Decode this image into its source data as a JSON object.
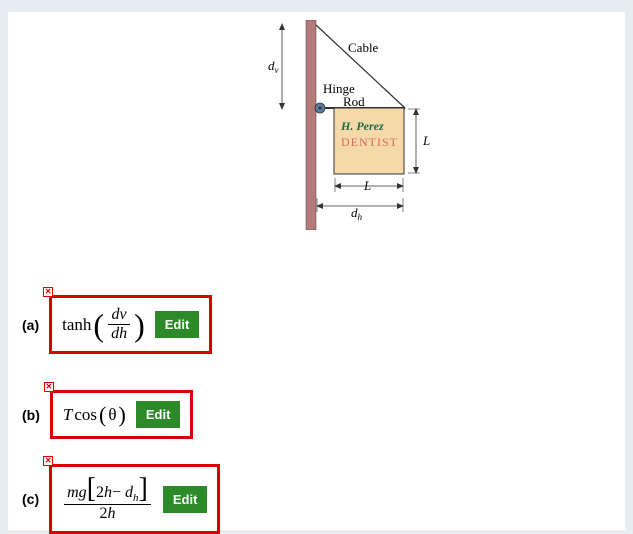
{
  "diagram": {
    "cable_label": "Cable",
    "hinge_label": "Hinge",
    "rod_label": "Rod",
    "sign_line1": "H. Perez",
    "sign_line2": "DENTIST",
    "dim_dv": "d",
    "dim_dv_sub": "v",
    "dim_dh": "d",
    "dim_dh_sub": "h",
    "dim_L_right": "L",
    "dim_L_bottom": "L"
  },
  "parts": {
    "a": {
      "label": "(a)",
      "fn": "tanh",
      "frac_num": "dv",
      "frac_den": "dh",
      "edit": "Edit"
    },
    "b": {
      "label": "(b)",
      "expr_T": "T",
      "expr_cos": "cos",
      "expr_theta": "θ",
      "edit": "Edit"
    },
    "c": {
      "label": "(c)",
      "num_mg": "mg",
      "num_bracket": "2h− d",
      "num_bracket_sub": "h",
      "den": "2h",
      "edit": "Edit"
    }
  }
}
